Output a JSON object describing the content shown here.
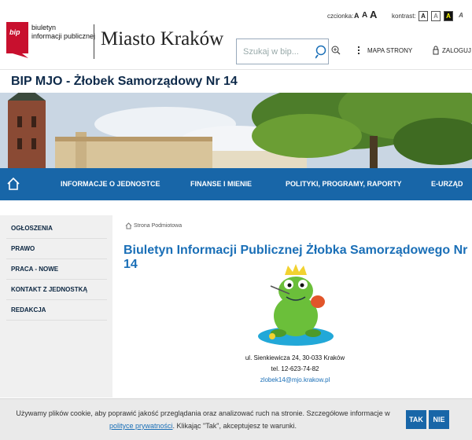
{
  "header": {
    "logo_line1": "biuletyn",
    "logo_line2": "informacji publicznej",
    "logo_mark": "bip",
    "city_title": "Miasto Kraków",
    "font_label": "czcionka:",
    "font_sizes": [
      "A",
      "A",
      "A"
    ],
    "contrast_label": "kontrast:",
    "contrast_options": [
      "A",
      "A",
      "A",
      "A"
    ],
    "search_placeholder": "Szukaj w bip...",
    "sitemap_label": "MAPA STRONY",
    "login_label": "ZALOGUJ"
  },
  "unit_title": "BIP MJO - Żłobek Samorządowy Nr 14",
  "nav": {
    "items": [
      "INFORMACJE O JEDNOSTCE",
      "FINANSE I MIENIE",
      "POLITYKI, PROGRAMY, RAPORTY",
      "E-URZĄD"
    ]
  },
  "sidebar": {
    "items": [
      "OGŁOSZENIA",
      "PRAWO",
      "PRACA - NOWE",
      "KONTAKT Z JEDNOSTKĄ",
      "REDAKCJA"
    ]
  },
  "main": {
    "breadcrumb": "Strona Podmiotowa",
    "title": "Biuletyn Informacji Publicznej Żłobka Samorządowego Nr 14",
    "address": "ul. Sienkiewicza 24, 30-033 Kraków",
    "phone": "tel. 12-623-74-82",
    "email": "zlobek14@mjo.krakow.pl"
  },
  "cookie": {
    "text_before": "Używamy plików cookie, aby poprawić jakość przeglądania oraz analizować ruch na stronie. Szczegółowe informacje w ",
    "link": "polityce prywatności",
    "text_after": ". Klikając \"Tak\", akceptujesz te warunki.",
    "yes_label": "TAK",
    "no_label": "NIE"
  },
  "colors": {
    "nav_blue": "#1866a8",
    "title_blue": "#1a6fb7",
    "bip_red": "#c8102e"
  }
}
